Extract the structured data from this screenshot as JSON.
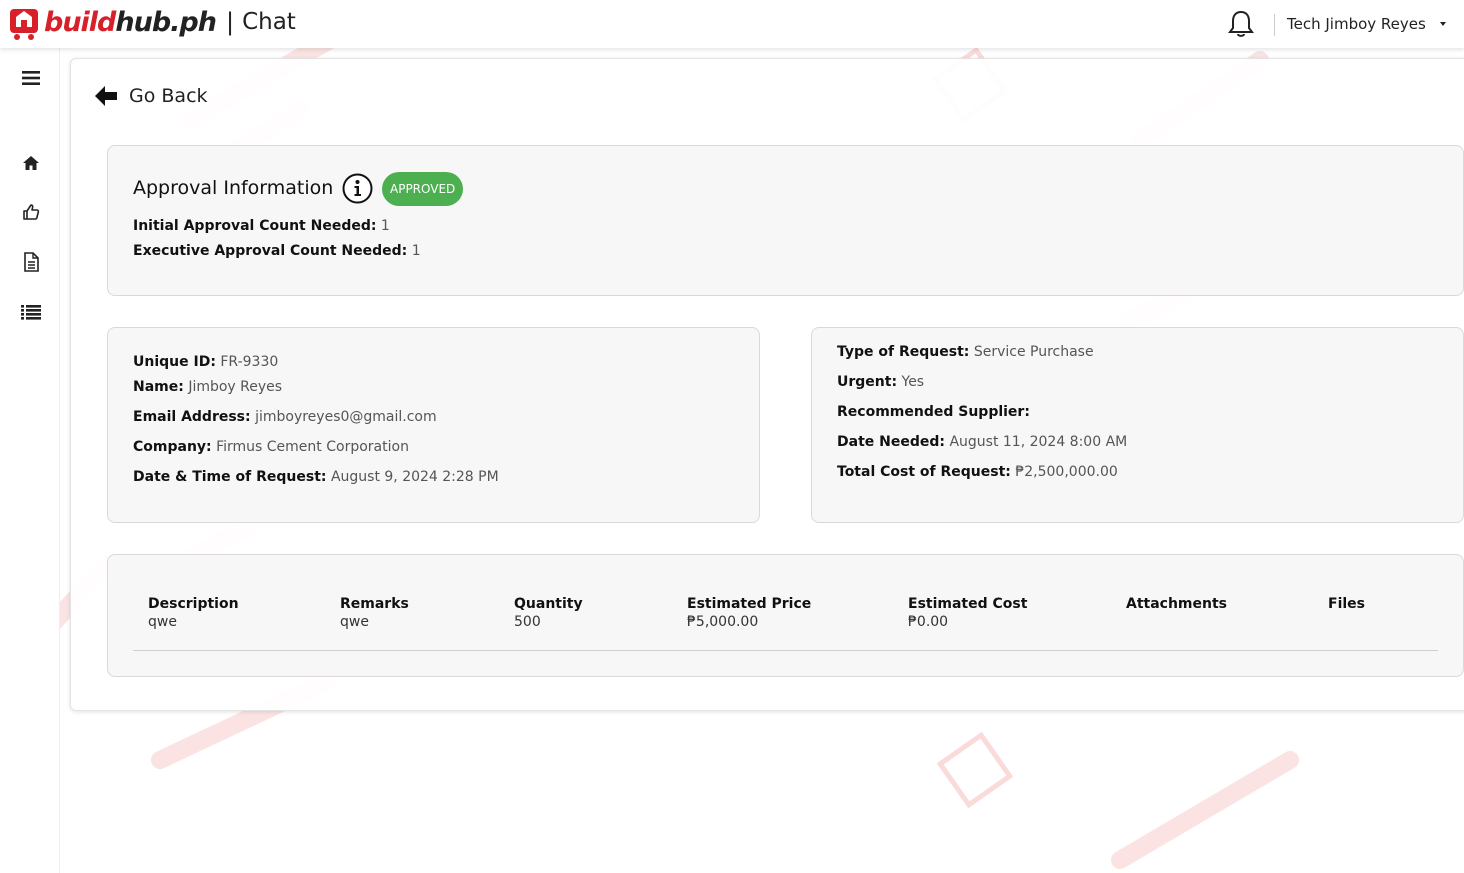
{
  "header": {
    "brand_part1": "build",
    "brand_part2": "hub.ph",
    "separator": "|",
    "section": "Chat",
    "user_name": "Tech Jimboy Reyes"
  },
  "sidebar": {
    "items": [
      {
        "icon": "menu-icon"
      },
      {
        "icon": "home-icon"
      },
      {
        "icon": "thumbs-up-icon"
      },
      {
        "icon": "document-icon"
      },
      {
        "icon": "list-icon"
      }
    ]
  },
  "nav": {
    "go_back_label": "Go Back"
  },
  "approval": {
    "title": "Approval Information",
    "status": "APPROVED",
    "status_color": "#4caf50",
    "initial_label": "Initial Approval Count Needed:",
    "initial_value": "1",
    "executive_label": "Executive Approval Count Needed:",
    "executive_value": "1"
  },
  "requester": {
    "unique_id_label": "Unique ID:",
    "unique_id": "FR-9330",
    "name_label": "Name:",
    "name": "Jimboy Reyes",
    "email_label": "Email Address:",
    "email": "jimboyreyes0@gmail.com",
    "company_label": "Company:",
    "company": "Firmus Cement Corporation",
    "datetime_label": "Date & Time of Request:",
    "datetime": "August 9, 2024 2:28 PM"
  },
  "request": {
    "type_label": "Type of Request:",
    "type": "Service Purchase",
    "urgent_label": "Urgent:",
    "urgent": "Yes",
    "supplier_label": "Recommended Supplier:",
    "supplier": "",
    "date_needed_label": "Date Needed:",
    "date_needed": "August 11, 2024 8:00 AM",
    "total_label": "Total Cost of Request:",
    "total": "₱2,500,000.00"
  },
  "items": {
    "columns": [
      "Description",
      "Remarks",
      "Quantity",
      "Estimated Price",
      "Estimated Cost",
      "Attachments",
      "Files"
    ],
    "rows": [
      [
        "qwe",
        "qwe",
        "500",
        "₱5,000.00",
        "₱0.00",
        "",
        ""
      ]
    ]
  },
  "colors": {
    "brand_red": "#d8202a",
    "accent_green": "#4caf50"
  }
}
